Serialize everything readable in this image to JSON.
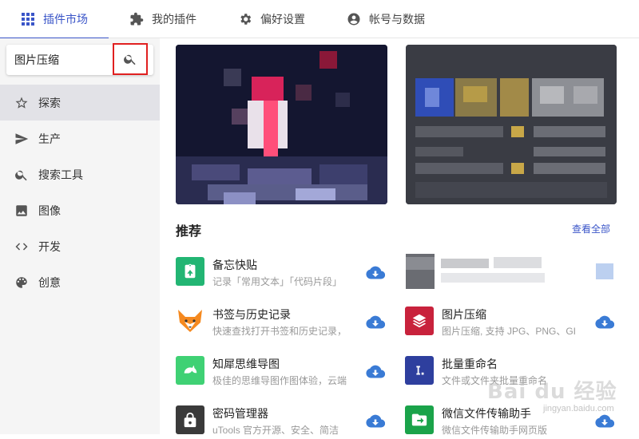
{
  "tabs": [
    {
      "label": "插件市场",
      "icon": "grid-icon",
      "active": true
    },
    {
      "label": "我的插件",
      "icon": "puzzle-icon",
      "active": false
    },
    {
      "label": "偏好设置",
      "icon": "gear-icon",
      "active": false
    },
    {
      "label": "帐号与数据",
      "icon": "account-icon",
      "active": false
    }
  ],
  "search": {
    "value": "图片压缩",
    "placeholder": ""
  },
  "sidebar": {
    "items": [
      {
        "label": "探索",
        "icon": "star-icon",
        "active": true
      },
      {
        "label": "生产",
        "icon": "send-icon",
        "active": false
      },
      {
        "label": "搜索工具",
        "icon": "search-icon",
        "active": false
      },
      {
        "label": "图像",
        "icon": "image-icon",
        "active": false
      },
      {
        "label": "开发",
        "icon": "code-icon",
        "active": false
      },
      {
        "label": "创意",
        "icon": "palette-icon",
        "active": false
      }
    ]
  },
  "main": {
    "section_title": "推荐",
    "see_all": "查看全部",
    "plugins_left": [
      {
        "name": "备忘快贴",
        "desc": "记录「常用文本」「代码片段」",
        "icon": "clipboard-icon",
        "color": "#22b573"
      },
      {
        "name": "书签与历史记录",
        "desc": "快速查找打开书签和历史记录，",
        "icon": "fox-icon",
        "color": "#ffffff"
      },
      {
        "name": "知犀思维导图",
        "desc": "极佳的思维导图作图体验，云端",
        "icon": "rhino-icon",
        "color": "#3fd174"
      },
      {
        "name": "密码管理器",
        "desc": "uTools 官方开源、安全、简洁",
        "icon": "lock-icon",
        "color": "#3a3a3a"
      }
    ],
    "plugins_right": [
      {
        "name": "图片压缩",
        "desc": "图片压缩, 支持 JPG、PNG、GI",
        "icon": "layers-icon",
        "color": "#c8223c"
      },
      {
        "name": "批量重命名",
        "desc": "文件或文件夹批量重命名",
        "icon": "rename-icon",
        "color": "#2e3f9e"
      },
      {
        "name": "微信文件传输助手",
        "desc": "微信文件传输助手网页版",
        "icon": "transfer-icon",
        "color": "#1aa34a"
      }
    ]
  },
  "watermark": {
    "text": "Bai du 经验",
    "sub": "jingyan.baidu.com"
  }
}
